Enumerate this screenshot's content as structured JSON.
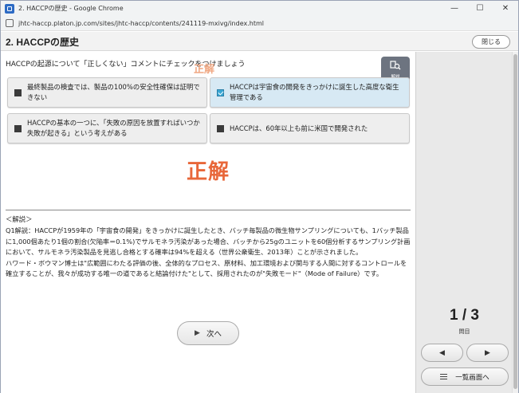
{
  "window": {
    "title": "2. HACCPの歴史 - Google Chrome",
    "url": "jhtc-haccp.platon.jp.com/sites/jhtc-haccp/contents/241119-mxivg/index.html",
    "controls": {
      "minimize": "—",
      "maximize": "☐",
      "close": "✕"
    }
  },
  "header": {
    "title": "2. HACCPの歴史",
    "close_label": "閉じる"
  },
  "question": {
    "text": "HACCPの起源について「正しくない」コメントにチェックをつけましょう",
    "hint_label": "解説",
    "correct_overlay_small": "正解",
    "correct_overlay_big": "正解"
  },
  "options": [
    {
      "text": "最終製品の検査では、製品の100%の安全性確保は証明できない",
      "checked": false
    },
    {
      "text": "HACCPは宇宙食の開発をきっかけに誕生した高度な衛生管理である",
      "checked": true
    },
    {
      "text": "HACCPの基本の一つに、「失敗の原因を放置すればいつか失敗が起きる」という考えがある",
      "checked": false
    },
    {
      "text": "HACCPは、60年以上も前に米国で開発された",
      "checked": false
    }
  ],
  "explanation": {
    "title": "＜解説＞",
    "body": "Q1解説：HACCPが1959年の「宇宙食の開発」をきっかけに誕生したとき、バッチ毎製品の微生物サンプリングについても、1バッチ製品に1,000個あたり1個の割合(欠陥率＝0.1%)でサルモネラ汚染があった場合、バッチから25gのユニットを60個分析するサンプリング計画において、サルモネラ汚染製品を見逃し合格とする確率は94%を超える（世界公衆衛生、2013年）ことが示されました。\nハワード・ボウマン博士は\"広範囲にわたる評価の後、全体的なプロセス、原材料、加工環境および関与する人間に対するコントロールを確立することが、我々が成功する唯一の道であると結論付けた\"として、採用されたのが\"失敗モード\"（Mode of Failure）です。"
  },
  "nav": {
    "next_label": "次へ",
    "page_current": "1",
    "page_total": "3",
    "page_count": "1 / 3",
    "page_unit": "問目",
    "prev_label": "◀",
    "next_arrow": "▶",
    "list_label": "一覧画面へ"
  }
}
